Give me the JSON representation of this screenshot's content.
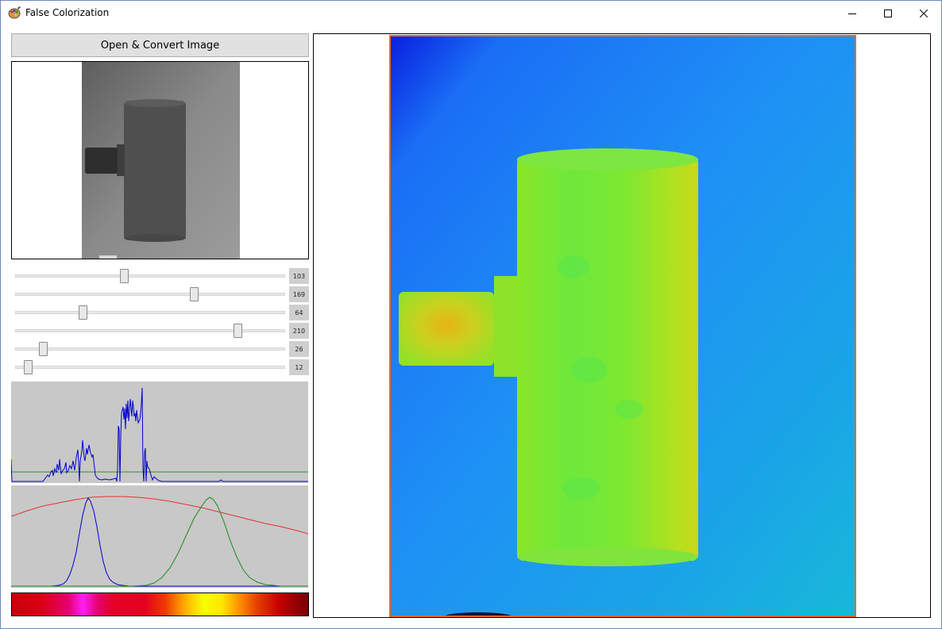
{
  "window": {
    "title": "False Colorization",
    "app_icon": "palette-icon",
    "controls": [
      "minimize-icon",
      "maximize-icon",
      "close-icon"
    ]
  },
  "open_button": {
    "label": "Open & Convert Image"
  },
  "sliders": [
    {
      "value": "103",
      "fraction": 0.404
    },
    {
      "value": "169",
      "fraction": 0.663
    },
    {
      "value": "64",
      "fraction": 0.251
    },
    {
      "value": "210",
      "fraction": 0.824
    },
    {
      "value": "26",
      "fraction": 0.102
    },
    {
      "value": "12",
      "fraction": 0.047
    }
  ],
  "colors": {
    "histogram_line": "#0000cc",
    "threshold_line": "#2e8b2e",
    "curve_red": "#e83030",
    "curve_green": "#1a8a1a",
    "curve_blue": "#0000d0",
    "panel_gray": "#c8c8c8",
    "frame_border": "#e86a1e"
  }
}
